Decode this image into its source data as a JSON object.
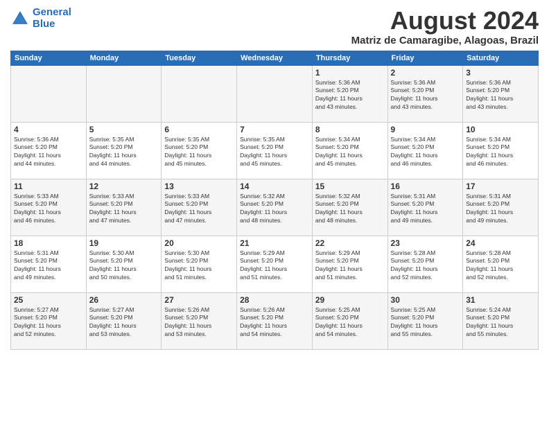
{
  "header": {
    "logo_line1": "General",
    "logo_line2": "Blue",
    "title": "August 2024",
    "subtitle": "Matriz de Camaragibe, Alagoas, Brazil"
  },
  "days_of_week": [
    "Sunday",
    "Monday",
    "Tuesday",
    "Wednesday",
    "Thursday",
    "Friday",
    "Saturday"
  ],
  "weeks": [
    [
      {
        "day": "",
        "info": ""
      },
      {
        "day": "",
        "info": ""
      },
      {
        "day": "",
        "info": ""
      },
      {
        "day": "",
        "info": ""
      },
      {
        "day": "1",
        "info": "Sunrise: 5:36 AM\nSunset: 5:20 PM\nDaylight: 11 hours\nand 43 minutes."
      },
      {
        "day": "2",
        "info": "Sunrise: 5:36 AM\nSunset: 5:20 PM\nDaylight: 11 hours\nand 43 minutes."
      },
      {
        "day": "3",
        "info": "Sunrise: 5:36 AM\nSunset: 5:20 PM\nDaylight: 11 hours\nand 43 minutes."
      }
    ],
    [
      {
        "day": "4",
        "info": "Sunrise: 5:36 AM\nSunset: 5:20 PM\nDaylight: 11 hours\nand 44 minutes."
      },
      {
        "day": "5",
        "info": "Sunrise: 5:35 AM\nSunset: 5:20 PM\nDaylight: 11 hours\nand 44 minutes."
      },
      {
        "day": "6",
        "info": "Sunrise: 5:35 AM\nSunset: 5:20 PM\nDaylight: 11 hours\nand 45 minutes."
      },
      {
        "day": "7",
        "info": "Sunrise: 5:35 AM\nSunset: 5:20 PM\nDaylight: 11 hours\nand 45 minutes."
      },
      {
        "day": "8",
        "info": "Sunrise: 5:34 AM\nSunset: 5:20 PM\nDaylight: 11 hours\nand 45 minutes."
      },
      {
        "day": "9",
        "info": "Sunrise: 5:34 AM\nSunset: 5:20 PM\nDaylight: 11 hours\nand 46 minutes."
      },
      {
        "day": "10",
        "info": "Sunrise: 5:34 AM\nSunset: 5:20 PM\nDaylight: 11 hours\nand 46 minutes."
      }
    ],
    [
      {
        "day": "11",
        "info": "Sunrise: 5:33 AM\nSunset: 5:20 PM\nDaylight: 11 hours\nand 46 minutes."
      },
      {
        "day": "12",
        "info": "Sunrise: 5:33 AM\nSunset: 5:20 PM\nDaylight: 11 hours\nand 47 minutes."
      },
      {
        "day": "13",
        "info": "Sunrise: 5:33 AM\nSunset: 5:20 PM\nDaylight: 11 hours\nand 47 minutes."
      },
      {
        "day": "14",
        "info": "Sunrise: 5:32 AM\nSunset: 5:20 PM\nDaylight: 11 hours\nand 48 minutes."
      },
      {
        "day": "15",
        "info": "Sunrise: 5:32 AM\nSunset: 5:20 PM\nDaylight: 11 hours\nand 48 minutes."
      },
      {
        "day": "16",
        "info": "Sunrise: 5:31 AM\nSunset: 5:20 PM\nDaylight: 11 hours\nand 49 minutes."
      },
      {
        "day": "17",
        "info": "Sunrise: 5:31 AM\nSunset: 5:20 PM\nDaylight: 11 hours\nand 49 minutes."
      }
    ],
    [
      {
        "day": "18",
        "info": "Sunrise: 5:31 AM\nSunset: 5:20 PM\nDaylight: 11 hours\nand 49 minutes."
      },
      {
        "day": "19",
        "info": "Sunrise: 5:30 AM\nSunset: 5:20 PM\nDaylight: 11 hours\nand 50 minutes."
      },
      {
        "day": "20",
        "info": "Sunrise: 5:30 AM\nSunset: 5:20 PM\nDaylight: 11 hours\nand 51 minutes."
      },
      {
        "day": "21",
        "info": "Sunrise: 5:29 AM\nSunset: 5:20 PM\nDaylight: 11 hours\nand 51 minutes."
      },
      {
        "day": "22",
        "info": "Sunrise: 5:29 AM\nSunset: 5:20 PM\nDaylight: 11 hours\nand 51 minutes."
      },
      {
        "day": "23",
        "info": "Sunrise: 5:28 AM\nSunset: 5:20 PM\nDaylight: 11 hours\nand 52 minutes."
      },
      {
        "day": "24",
        "info": "Sunrise: 5:28 AM\nSunset: 5:20 PM\nDaylight: 11 hours\nand 52 minutes."
      }
    ],
    [
      {
        "day": "25",
        "info": "Sunrise: 5:27 AM\nSunset: 5:20 PM\nDaylight: 11 hours\nand 52 minutes."
      },
      {
        "day": "26",
        "info": "Sunrise: 5:27 AM\nSunset: 5:20 PM\nDaylight: 11 hours\nand 53 minutes."
      },
      {
        "day": "27",
        "info": "Sunrise: 5:26 AM\nSunset: 5:20 PM\nDaylight: 11 hours\nand 53 minutes."
      },
      {
        "day": "28",
        "info": "Sunrise: 5:26 AM\nSunset: 5:20 PM\nDaylight: 11 hours\nand 54 minutes."
      },
      {
        "day": "29",
        "info": "Sunrise: 5:25 AM\nSunset: 5:20 PM\nDaylight: 11 hours\nand 54 minutes."
      },
      {
        "day": "30",
        "info": "Sunrise: 5:25 AM\nSunset: 5:20 PM\nDaylight: 11 hours\nand 55 minutes."
      },
      {
        "day": "31",
        "info": "Sunrise: 5:24 AM\nSunset: 5:20 PM\nDaylight: 11 hours\nand 55 minutes."
      }
    ]
  ]
}
